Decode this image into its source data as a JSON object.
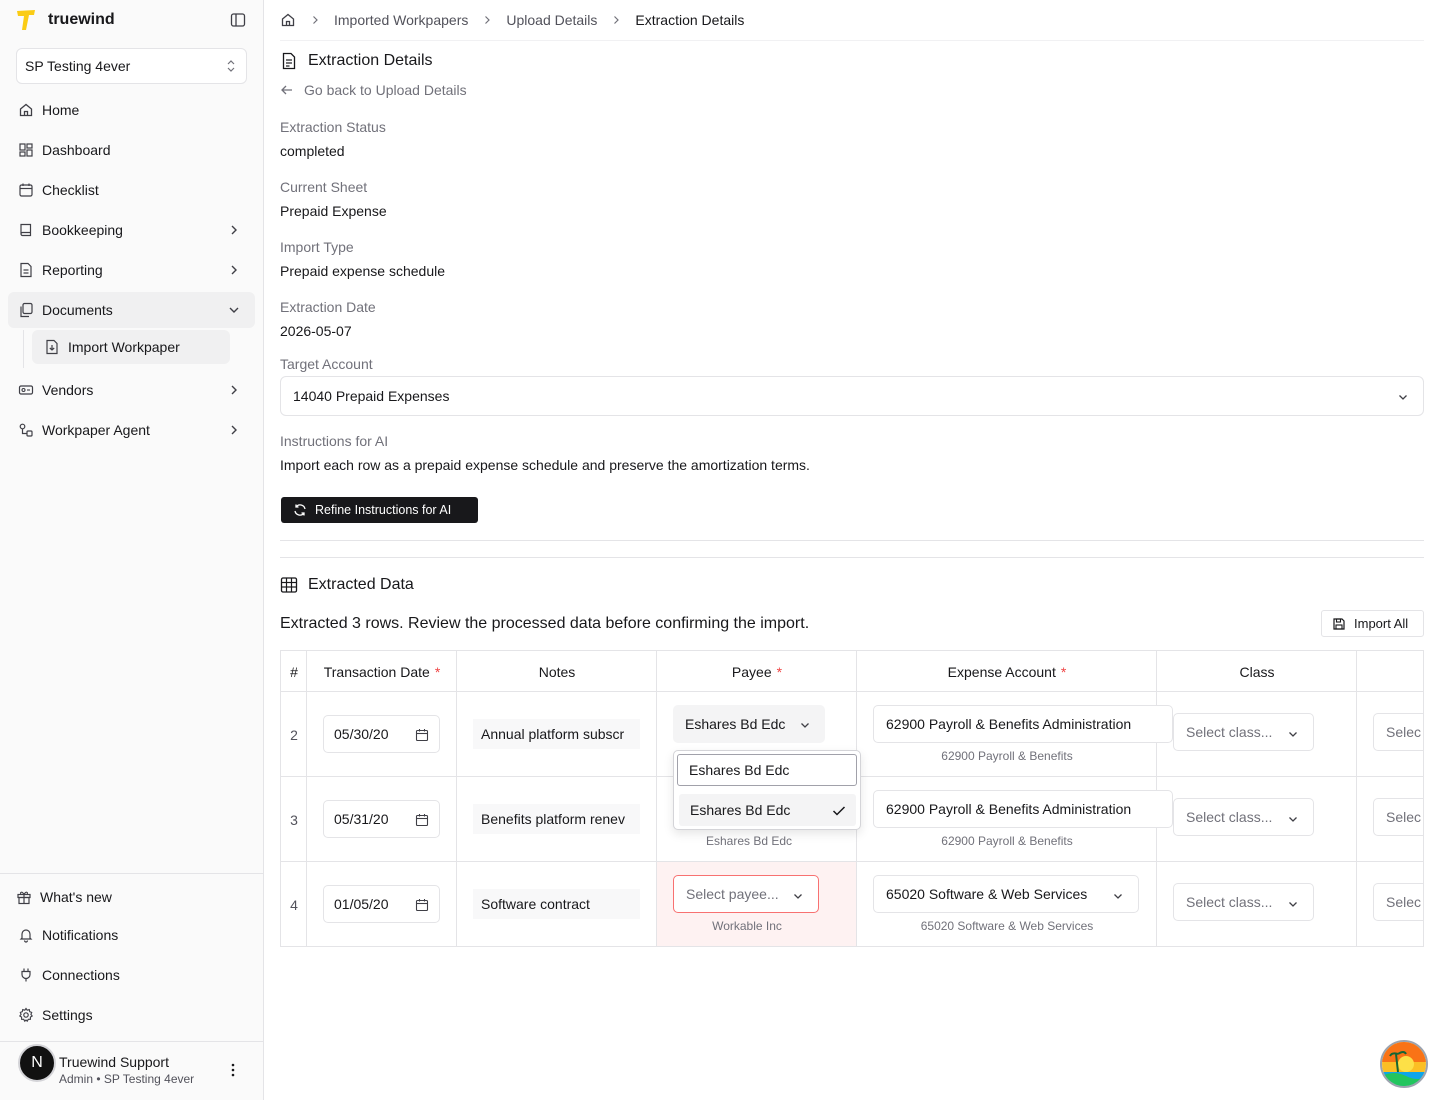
{
  "app": {
    "name": "truewind"
  },
  "sidebar": {
    "org_selector": "SP Testing 4ever",
    "nav": [
      {
        "label": "Home",
        "icon": "home-icon"
      },
      {
        "label": "Dashboard",
        "icon": "dashboard-icon"
      },
      {
        "label": "Checklist",
        "icon": "calendar-icon"
      },
      {
        "label": "Bookkeeping",
        "icon": "book-icon"
      },
      {
        "label": "Reporting",
        "icon": "report-icon"
      },
      {
        "label": "Documents",
        "icon": "documents-icon"
      },
      {
        "label": "Vendors",
        "icon": "vendor-icon"
      },
      {
        "label": "Workpaper Agent",
        "icon": "agent-icon"
      }
    ],
    "sub_item": "Import Workpaper",
    "footer": [
      {
        "label": "What's new",
        "icon": "gift-icon"
      },
      {
        "label": "Notifications",
        "icon": "bell-icon"
      },
      {
        "label": "Connections",
        "icon": "plug-icon"
      },
      {
        "label": "Settings",
        "icon": "gear-icon"
      }
    ],
    "user": {
      "initial": "N",
      "name": "Truewind Support",
      "role": "Admin • SP Testing 4ever"
    }
  },
  "breadcrumb": [
    "Imported Workpapers",
    "Upload Details",
    "Extraction Details"
  ],
  "page": {
    "title": "Extraction Details",
    "back_link": "Go back to Upload Details",
    "fields": [
      {
        "label": "Extraction Status",
        "value": "completed"
      },
      {
        "label": "Current Sheet",
        "value": "Prepaid Expense"
      },
      {
        "label": "Import Type",
        "value": "Prepaid expense schedule"
      },
      {
        "label": "Extraction Date",
        "value": "2026-05-07"
      }
    ],
    "target_account_label": "Target Account",
    "target_account_value": "14040 Prepaid Expenses",
    "instructions_label": "Instructions for AI",
    "instructions_value": "Import each row as a prepaid expense schedule and preserve the amortization terms.",
    "refine_button": "Refine Instructions for AI"
  },
  "extracted": {
    "title": "Extracted Data",
    "summary": "Extracted 3 rows. Review the processed data before confirming the import.",
    "import_all": "Import All",
    "columns": [
      "#",
      "Transaction Date",
      "Notes",
      "Payee",
      "Expense Account",
      "Class"
    ],
    "required_mark": "*",
    "rows": [
      {
        "num": "2",
        "date": "05/30/20",
        "notes": "Annual platform subscr",
        "payee": "Eshares Bd Edc",
        "payee_sub": "",
        "account": "62900 Payroll & Benefits Administration",
        "account_sub": "62900 Payroll & Benefits",
        "class": "Select class...",
        "extra": "Selec"
      },
      {
        "num": "3",
        "date": "05/31/20",
        "notes": "Benefits platform renev",
        "payee": "",
        "payee_sub": "Eshares Bd Edc",
        "account": "62900 Payroll & Benefits Administration",
        "account_sub": "62900 Payroll & Benefits",
        "class": "Select class...",
        "extra": "Selec"
      },
      {
        "num": "4",
        "date": "01/05/20",
        "notes": "Software contract",
        "payee": "Select payee...",
        "payee_sub": "Workable Inc",
        "account": "65020 Software & Web Services",
        "account_sub": "65020 Software & Web Services",
        "class": "Select class...",
        "extra": "Selec"
      }
    ]
  },
  "popover": {
    "search_value": "Eshares Bd Edc",
    "option": "Eshares Bd Edc"
  },
  "colors": {
    "accent": "#18181b",
    "error_bg": "#fef2f2",
    "error_border": "#f87171",
    "required": "#ef4444",
    "logo": "#facc15"
  }
}
